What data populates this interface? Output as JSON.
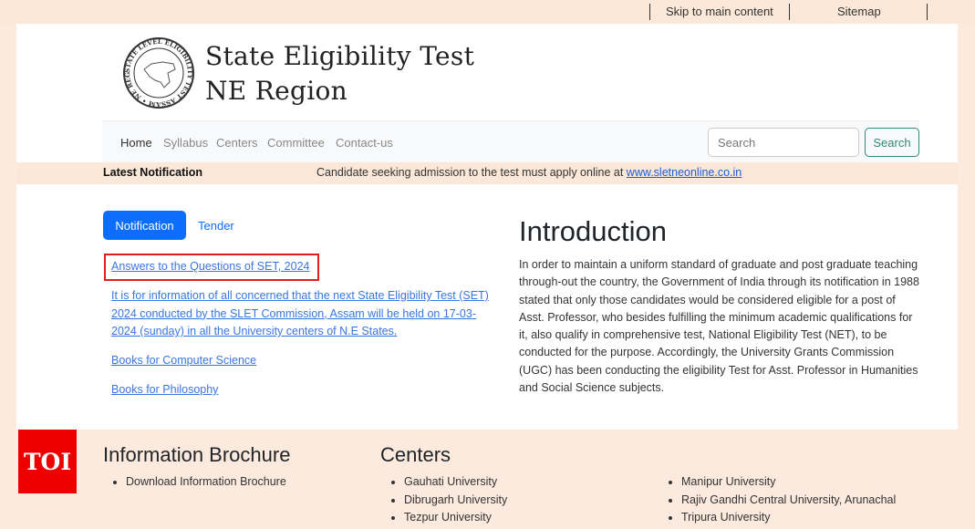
{
  "topbar": {
    "skip_link": "Skip to main content",
    "sitemap_link": "Sitemap"
  },
  "header": {
    "logo_text": "STATE LEVEL ELIGIBILITY TEST ASSAM • NE REGION •",
    "title_line1": "State Eligibility Test",
    "title_line2": "NE Region"
  },
  "nav": {
    "items": [
      {
        "label": "Home",
        "active": true
      },
      {
        "label": "Syllabus",
        "active": false
      },
      {
        "label": "Centers",
        "active": false
      },
      {
        "label": "Committee",
        "active": false
      },
      {
        "label": "Contact-us",
        "active": false
      }
    ],
    "search_placeholder": "Search",
    "search_value": "",
    "search_button": "Search"
  },
  "latest_notification": {
    "label": "Latest Notification",
    "text": "Candidate seeking admission to the test must apply online at ",
    "link": "www.sletneonline.co.in"
  },
  "tabs": {
    "items": [
      {
        "label": "Notification",
        "active": true
      },
      {
        "label": "Tender",
        "active": false
      }
    ]
  },
  "notifications": [
    {
      "text": "Answers to the Questions of SET, 2024",
      "highlighted": true
    },
    {
      "text": "It is for information of all concerned that the next State Eligibility Test (SET) 2024 conducted by the SLET Commission, Assam will be held on 17-03-2024 (sunday) in all the University centers of N.E States.",
      "highlighted": false
    },
    {
      "text": "Books for Computer Science",
      "highlighted": false
    },
    {
      "text": "Books for Philosophy",
      "highlighted": false
    }
  ],
  "introduction": {
    "title": "Introduction",
    "body": "In order to maintain a uniform standard of graduate and post graduate teaching through-out the country, the Government of India through its notification in 1988 stated that only those candidates would be considered eligible for a post of Asst. Professor, who besides fulfilling the minimum academic qualifications for it, also qualify in comprehensive test, National Eligibility Test (NET), to be conducted for the purpose. Accordingly, the University Grants Commission (UGC) has been conducting the eligibility Test for Asst. Professor in Humanities and Social Science subjects."
  },
  "footer": {
    "watermark": "TOI",
    "brochure": {
      "title": "Information Brochure",
      "items": [
        "Download Information Brochure"
      ]
    },
    "centers": {
      "title": "Centers",
      "col1": [
        "Gauhati University",
        "Dibrugarh University",
        "Tezpur University"
      ],
      "col2": [
        "Manipur University",
        "Rajiv Gandhi Central University, Arunachal",
        "Tripura University"
      ]
    }
  },
  "colors": {
    "accent_blue": "#0d6efd",
    "link_blue": "#3a76e0",
    "highlight_red": "#e01e1e",
    "peach_bg": "#fbeadd",
    "search_green": "#2e8b6e",
    "toi_red": "#ee0000"
  }
}
